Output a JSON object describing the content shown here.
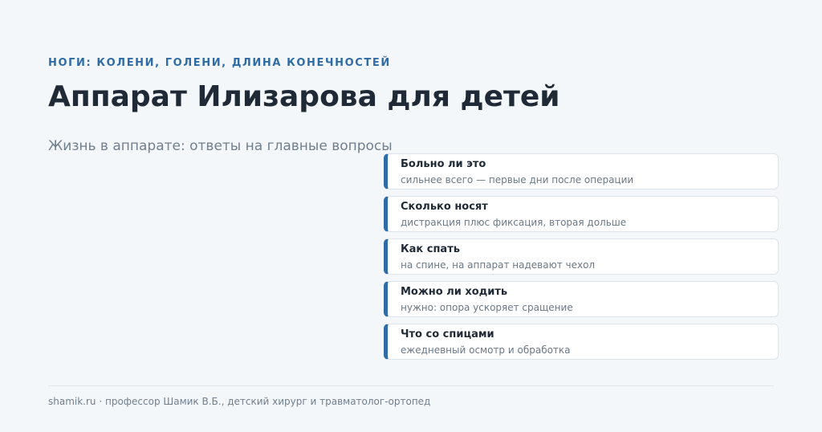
{
  "header": {
    "eyebrow": "НОГИ: КОЛЕНИ, ГОЛЕНИ, ДЛИНА КОНЕЧНОСТЕЙ",
    "title": "Аппарат Илизарова для детей",
    "subtitle": "Жизнь в аппарате: ответы на главные вопросы"
  },
  "cards": [
    {
      "title": "Больно ли это",
      "desc": "сильнее всего — первые дни после операции"
    },
    {
      "title": "Сколько носят",
      "desc": "дистракция плюс фиксация, вторая дольше"
    },
    {
      "title": "Как спать",
      "desc": "на спине, на аппарат надевают чехол"
    },
    {
      "title": "Можно ли ходить",
      "desc": "нужно: опора ускоряет сращение"
    },
    {
      "title": "Что со спицами",
      "desc": "ежедневный осмотр и обработка"
    }
  ],
  "footer": {
    "text": "shamik.ru · профессор Шамик В.Б., детский хирург и травматолог-ортопед"
  },
  "colors": {
    "accent": "#2f6ca6",
    "background": "#f4f7fa",
    "heading": "#1f2a36",
    "muted": "#707f8e"
  }
}
